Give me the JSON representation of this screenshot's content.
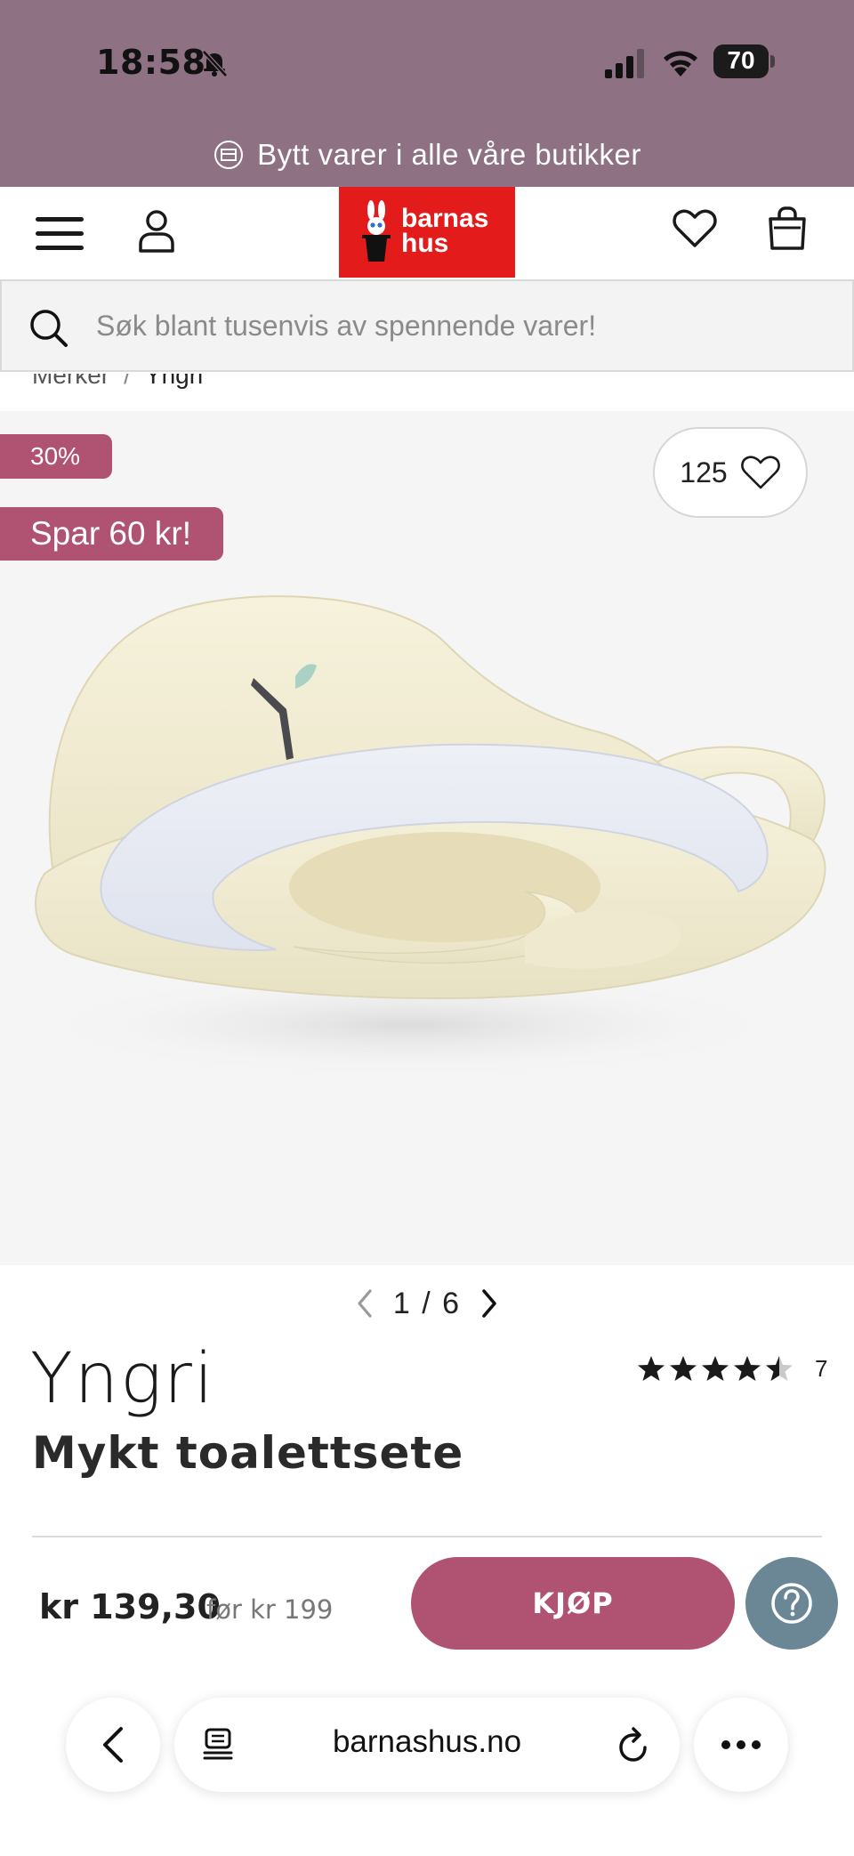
{
  "status_bar": {
    "time": "18:58",
    "battery": "70"
  },
  "promo": {
    "text": "Bytt varer i alle våre butikker"
  },
  "header": {
    "logo_line1": "barnas",
    "logo_line2": "hus"
  },
  "search": {
    "placeholder": "Søk blant tusenvis av spennende varer!"
  },
  "breadcrumb": {
    "items": [
      "Merker",
      "Yngri"
    ],
    "separator": "/"
  },
  "gallery": {
    "discount_badge": "30%",
    "save_badge": "Spar 60 kr!",
    "wishlist_count": "125",
    "pager": "1 / 6"
  },
  "product": {
    "brand": "Yngri",
    "title": "Mykt toalettsete",
    "rating_value": 4.5,
    "rating_count": "7",
    "price": "kr 139,30",
    "price_before": "før kr 199",
    "buy_label": "KJØP"
  },
  "browser": {
    "url": "barnashus.no"
  },
  "colors": {
    "accent": "#b05272",
    "top_band": "#8e7283",
    "logo_red": "#e31b1b",
    "help_button": "#6b8796"
  }
}
